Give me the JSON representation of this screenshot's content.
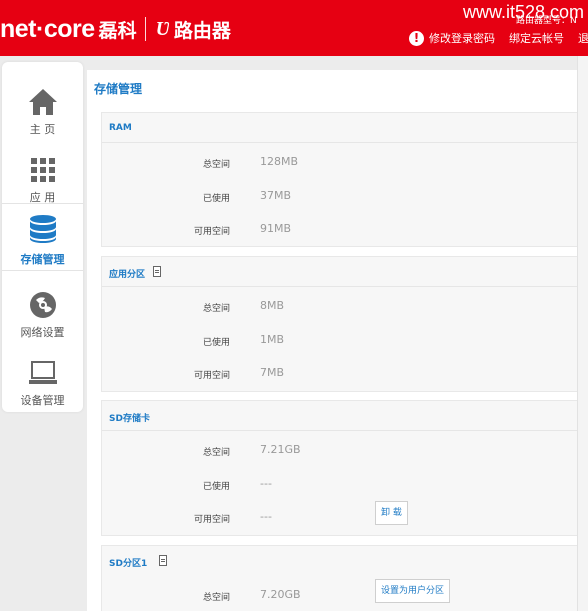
{
  "header": {
    "logo_brand": "net·core",
    "logo_cn": "磊科",
    "logo_mark": "Ʋ",
    "logo_router": "路由器",
    "watermark": "www.it528.com",
    "small_text": "路由器型号：N",
    "links": {
      "change_password": "修改登录密码",
      "bind_cloud": "绑定云帐号",
      "logout": "退"
    },
    "warn_glyph": "!"
  },
  "sidebar": {
    "items": [
      {
        "label": "主  页",
        "icon": "home-icon"
      },
      {
        "label": "应  用",
        "icon": "apps-grid-icon"
      },
      {
        "label": "存储管理",
        "icon": "storage-database-icon",
        "active": true
      },
      {
        "label": "网络设置",
        "icon": "network-settings-icon"
      },
      {
        "label": "设备管理",
        "icon": "device-laptop-icon"
      }
    ]
  },
  "main": {
    "title": "存储管理",
    "sections": [
      {
        "title": "RAM",
        "rows": [
          {
            "key": "总空间",
            "value": "128MB"
          },
          {
            "key": "已使用",
            "value": "37MB"
          },
          {
            "key": "可用空间",
            "value": "91MB"
          }
        ]
      },
      {
        "title": "应用分区",
        "has_icon": true,
        "rows": [
          {
            "key": "总空间",
            "value": "8MB"
          },
          {
            "key": "已使用",
            "value": "1MB"
          },
          {
            "key": "可用空间",
            "value": "7MB"
          }
        ]
      },
      {
        "title": "SD存储卡",
        "rows": [
          {
            "key": "总空间",
            "value": "7.21GB"
          },
          {
            "key": "已使用",
            "value": "---"
          },
          {
            "key": "可用空间",
            "value": "---"
          }
        ],
        "button": "卸  载"
      },
      {
        "title": "SD分区1",
        "has_icon": true,
        "rows": [
          {
            "key": "总空间",
            "value": "7.20GB"
          }
        ],
        "button": "设置为用户分区"
      }
    ]
  },
  "colors": {
    "header_red": "#e60012",
    "accent_blue": "#1f7bc5",
    "icon_gray": "#666666"
  }
}
